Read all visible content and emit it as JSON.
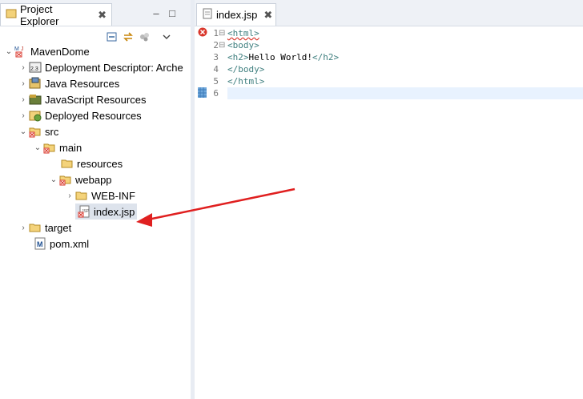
{
  "left_panel": {
    "tab_label": "Project Explorer",
    "tab_close": "✖",
    "toolbar": {
      "collapse_icon": "collapse-all-icon",
      "link_icon": "link-editor-icon",
      "focus_icon": "focus-icon",
      "menu_icon": "view-menu-icon",
      "minimize": "–",
      "maximize": "□"
    },
    "tree": [
      {
        "label": "MavenDome",
        "depth": 0,
        "twisty": "⌄",
        "icon": "maven-project-icon"
      },
      {
        "label": "Deployment Descriptor: Arche",
        "depth": 1,
        "twisty": "›",
        "icon": "deployment-descriptor-icon"
      },
      {
        "label": "Java Resources",
        "depth": 1,
        "twisty": "›",
        "icon": "java-resources-icon"
      },
      {
        "label": "JavaScript Resources",
        "depth": 1,
        "twisty": "›",
        "icon": "javascript-resources-icon"
      },
      {
        "label": "Deployed Resources",
        "depth": 1,
        "twisty": "›",
        "icon": "deployed-resources-icon"
      },
      {
        "label": "src",
        "depth": 1,
        "twisty": "⌄",
        "icon": "folder-error-icon"
      },
      {
        "label": "main",
        "depth": 2,
        "twisty": "⌄",
        "icon": "folder-error-icon"
      },
      {
        "label": "resources",
        "depth": 3,
        "twisty": "",
        "icon": "folder-icon"
      },
      {
        "label": "webapp",
        "depth": 3,
        "twisty": "⌄",
        "icon": "folder-error-icon"
      },
      {
        "label": "WEB-INF",
        "depth": 4,
        "twisty": "›",
        "icon": "folder-icon"
      },
      {
        "label": "index.jsp",
        "depth": 4,
        "twisty": "",
        "icon": "jsp-file-error-icon",
        "selected": true
      },
      {
        "label": "target",
        "depth": 1,
        "twisty": "›",
        "icon": "folder-icon"
      },
      {
        "label": "pom.xml",
        "depth": 1,
        "twisty": "",
        "icon": "maven-pom-icon"
      }
    ]
  },
  "editor": {
    "tab_label": "index.jsp",
    "tab_close": "✖",
    "lines": [
      {
        "num": "1",
        "fold": "⊟",
        "text": "<html>"
      },
      {
        "num": "2",
        "fold": "⊟",
        "text": "<body>"
      },
      {
        "num": "3",
        "fold": "",
        "open": "<h2>",
        "content": "Hello World!",
        "close": "</h2>"
      },
      {
        "num": "4",
        "fold": "",
        "text": "</body>"
      },
      {
        "num": "5",
        "fold": "",
        "text": "</html>"
      },
      {
        "num": "6",
        "fold": "",
        "text": ""
      }
    ]
  },
  "colors": {
    "tag": "#3f7f7f",
    "annotation_arrow": "#e02020",
    "error_marker": "#d9362b"
  }
}
